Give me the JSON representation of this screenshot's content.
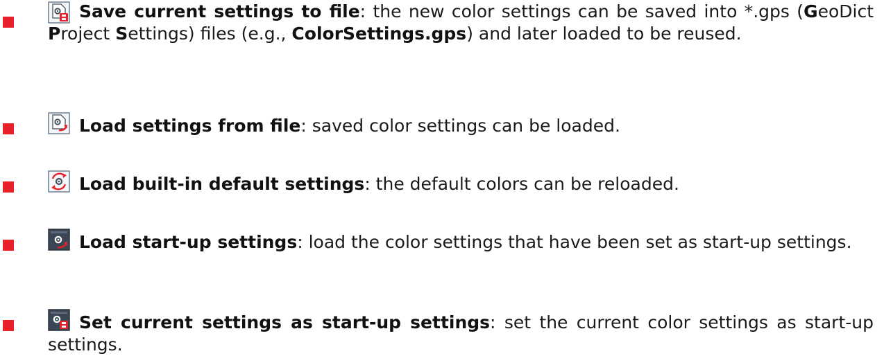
{
  "colors": {
    "bullet": "#e8202a",
    "icon_accent": "#e8202a",
    "icon_frame": "#6d7f93"
  },
  "items": [
    {
      "icon": "save-settings-icon",
      "title": "Save current settings to file",
      "text_part_1": ": the new color settings can be saved into *.gps (",
      "g_bold": "G",
      "g_rest": "eoDict ",
      "p_bold": "P",
      "p_rest": "roject ",
      "s_bold": "S",
      "s_rest": "ettings) files (e.g., ",
      "file_name": "ColorSettings.gps",
      "text_part_2": ") and later loaded to be reused."
    },
    {
      "icon": "load-settings-icon",
      "title": "Load settings from file",
      "text": ": saved color settings can be loaded."
    },
    {
      "icon": "reload-defaults-icon",
      "title": "Load built-in default settings",
      "text": ": the default colors can be reloaded."
    },
    {
      "icon": "load-startup-icon",
      "title": "Load start-up settings",
      "text": ": load the color settings that have been set as start-up settings."
    },
    {
      "icon": "set-startup-icon",
      "title": "Set current settings as start-up settings",
      "text": ": set the current color settings as start-up settings."
    }
  ]
}
